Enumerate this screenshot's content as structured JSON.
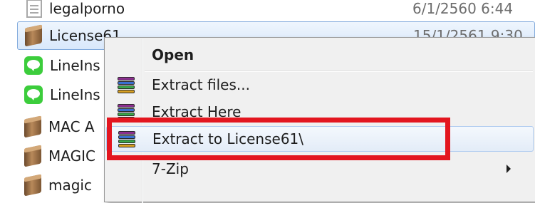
{
  "file_list": {
    "rows": [
      {
        "name": "legalporno",
        "date": "6/1/2560 6:44",
        "icon": "document-icon"
      },
      {
        "name": "License61",
        "date": "15/1/2561 9:30",
        "icon": "winrar-archive-icon",
        "selected": true
      },
      {
        "name": "LineIns",
        "icon": "line-app-icon"
      },
      {
        "name": "LineIns",
        "icon": "line-app-icon"
      },
      {
        "name": "MAC A",
        "icon": "winrar-archive-icon"
      },
      {
        "name": "MAGIC",
        "icon": "winrar-archive-icon"
      },
      {
        "name": "magic",
        "icon": "winrar-archive-icon"
      }
    ]
  },
  "context_menu": {
    "items": [
      {
        "label": "Open",
        "bold": true
      },
      {
        "label": "Extract files...",
        "icon": "winrar-icon"
      },
      {
        "label": "Extract Here",
        "icon": "winrar-icon"
      },
      {
        "label": "Extract to License61\\",
        "icon": "winrar-icon",
        "highlighted": true
      },
      {
        "label": "7-Zip",
        "submenu": true
      }
    ]
  },
  "colors": {
    "annotation": "#e3161f",
    "selection": "#d9e8fb",
    "menu_background": "#f0f0f0"
  }
}
